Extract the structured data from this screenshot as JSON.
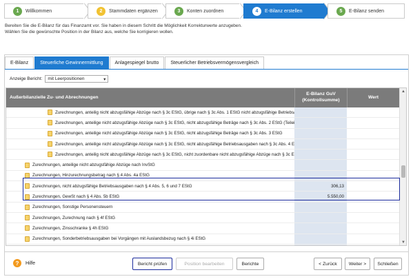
{
  "wizard": {
    "steps": [
      {
        "num": "1",
        "label": "Willkommen",
        "color": "#6aa84f"
      },
      {
        "num": "2",
        "label": "Stammdaten ergänzen",
        "color": "#f1c232"
      },
      {
        "num": "3",
        "label": "Konten zuordnen",
        "color": "#6aa84f"
      },
      {
        "num": "4",
        "label": "E-Bilanz erstellen",
        "color": "#1f7bd0"
      },
      {
        "num": "5",
        "label": "E-Bilanz senden",
        "color": "#6aa84f"
      }
    ]
  },
  "intro": {
    "line1": "Bereiten Sie die E-Bilanz für das Finanzamt vor. Sie haben in diesem Schritt die Möglichkeit Korrekturwerte anzugeben.",
    "line2": "Wählen Sie die gewünschte Position in der Bilanz aus, welche Sie korrigieren wollen."
  },
  "tabs": [
    "E-Bilanz",
    "Steuerliche Gewinnermittlung",
    "Anlagespiegel brutto",
    "Steuerlicher Betriebsvermögensvergleich"
  ],
  "anzeige": {
    "label": "Anzeige Bericht:",
    "value": "mit Leerpositionen",
    "arrow": "▾"
  },
  "grid": {
    "headers": {
      "col1": "Außerbilanzielle Zu- und Abrechnungen",
      "col2_line1": "E-Bilanz GuV",
      "col2_line2": "(Kontrollsumme)",
      "col3": "Wert"
    },
    "rows": [
      {
        "text": "Zurechnungen, anteilig nicht abzugsfähige Abzüge nach § 3c EStG, übrige nach § 3c Abs. 1 EStG nicht abzugsfähige Betriebsausg",
        "value": "",
        "indent": 2
      },
      {
        "text": "Zurechnungen, anteilige nicht abzugsfähige Abzüge nach § 3c EStG, nicht abzugsfähige Beträge nach § 3c Abs. 2 EStG (Teileinkün",
        "value": "",
        "indent": 2
      },
      {
        "text": "Zurechnungen, anteilige nicht abzugsfähige Abzüge nach § 3c EStG, nicht abzugsfähige Beträge nach § 3c Abs. 3 EStG",
        "value": "",
        "indent": 2
      },
      {
        "text": "Zurechnungen, anteilige nicht abzugsfähige Abzüge nach § 3c EStG, nicht abzugsfähige Betriebsausgaben nach § 3c Abs. 4 EStG in",
        "value": "",
        "indent": 2
      },
      {
        "text": "Zurechnungen, anteilig nicht abzugsfähige Abzüge nach § 3c EStG, nicht zuordenbare nicht abzugsfähige Abzüge nach § 3c EStG",
        "value": "",
        "indent": 2
      },
      {
        "text": "Zurechnungen, anteilige nicht abzugsfähige Abzüge nach InvStG",
        "value": "",
        "indent": 1
      },
      {
        "text": "Zurechnungen, Hinzurechnungsbetrag nach § 4 Abs. 4a EStG",
        "value": "",
        "indent": 1
      },
      {
        "text": "Zurechnungen, nicht abzugsfähige Betriebsausgaben nach § 4 Abs. 5, 6 und 7 EStG",
        "value": "306,13",
        "indent": 1
      },
      {
        "text": "Zurechnungen, GewSt nach § 4 Abs. 5b EStG",
        "value": "5.550,00",
        "indent": 1
      },
      {
        "text": "Zurechnungen, Sonstige Personensteuern",
        "value": "",
        "indent": 1
      },
      {
        "text": "Zurechnungen, Zurechnung nach § 4f EStG",
        "value": "",
        "indent": 1
      },
      {
        "text": "Zurechnungen, Zinsschranke § 4h EStG",
        "value": "",
        "indent": 1
      },
      {
        "text": "Zurechnungen, Sonderbetriebsausgaben bei Vorgängen mit Auslandsbezug nach § 4i EStG",
        "value": "",
        "indent": 1
      },
      {
        "text": "",
        "value": "",
        "indent": 1
      }
    ]
  },
  "footer": {
    "help": "Hilfe",
    "help_glyph": "?",
    "buttons": {
      "bericht_pruefen": "Bericht prüfen",
      "position_bearbeiten": "Position bearbeiten",
      "berichte": "Berichte",
      "zurueck": "< Zurück",
      "weiter": "Weiter >",
      "schliessen": "Schließen"
    }
  },
  "scrollbar": {
    "up": "▲",
    "down": "▼"
  }
}
